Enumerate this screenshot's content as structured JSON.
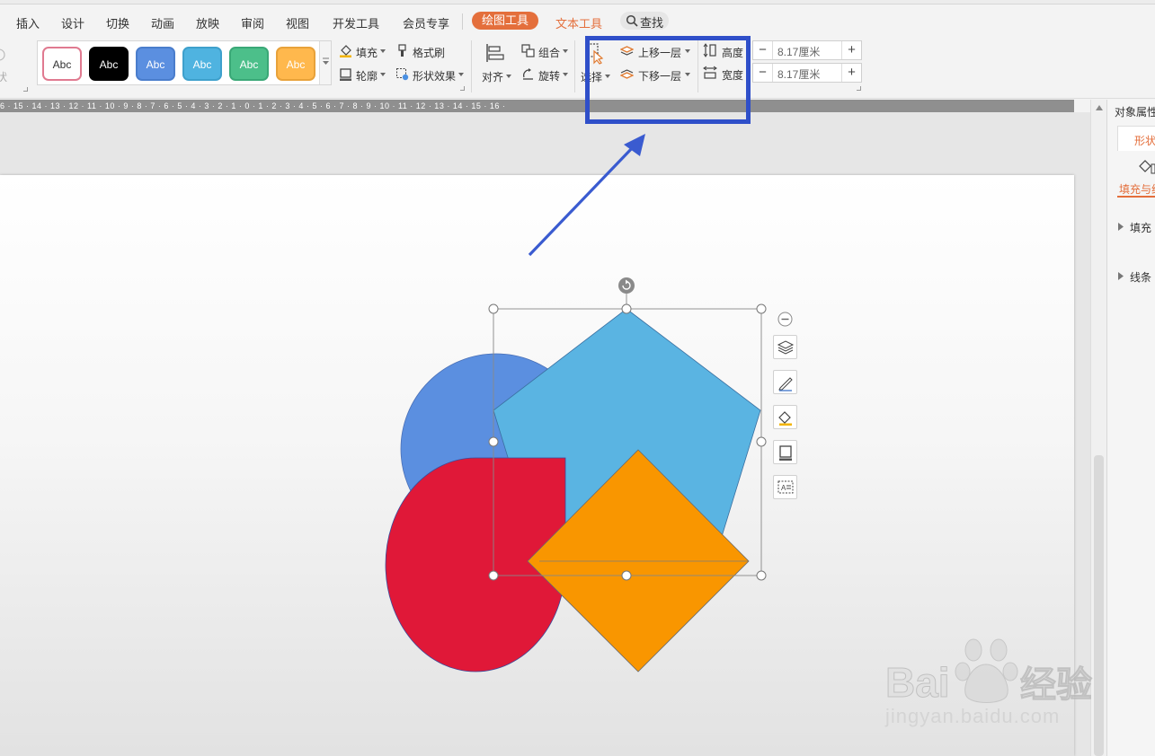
{
  "menu": {
    "items": [
      "插入",
      "设计",
      "切换",
      "动画",
      "放映",
      "审阅",
      "视图",
      "开发工具",
      "会员专享"
    ],
    "drawing_tools": "绘图工具",
    "text_tools": "文本工具",
    "search": "查找"
  },
  "ribbon": {
    "partial_shape": "状",
    "style_swatches": [
      {
        "label": "Abc",
        "bg": "#ffffff",
        "fg": "#333333",
        "border": "#e07a90"
      },
      {
        "label": "Abc",
        "bg": "#000000",
        "fg": "#ffffff",
        "border": "#000000"
      },
      {
        "label": "Abc",
        "bg": "#5b8fe0",
        "fg": "#ffffff",
        "border": "#4a7dcc"
      },
      {
        "label": "Abc",
        "bg": "#4fb3e0",
        "fg": "#ffffff",
        "border": "#3ea0cc"
      },
      {
        "label": "Abc",
        "bg": "#4cbf8a",
        "fg": "#ffffff",
        "border": "#3aa877"
      },
      {
        "label": "Abc",
        "bg": "#ffb84d",
        "fg": "#ffffff",
        "border": "#e8a23a"
      }
    ],
    "fill": "填充",
    "outline": "轮廓",
    "format_painter": "格式刷",
    "shape_effects": "形状效果",
    "align": "对齐",
    "group": "组合",
    "rotate": "旋转",
    "select": "选择",
    "bring_forward": "上移一层",
    "send_backward": "下移一层",
    "height_label": "高度",
    "width_label": "宽度",
    "height_value": "8.17厘米",
    "width_value": "8.17厘米",
    "minus": "−",
    "plus": "+"
  },
  "ruler": {
    "text": "6 · 15 · 14 · 13 · 12 · 11 · 10 · 9 · 8 · 7 · 6 · 5 · 4 · 3 · 2 · 1 · 0 · 1 · 2 · 3 · 4 · 5 · 6 · 7 · 8 · 9 · 10 · 11 · 12 · 13 · 14 · 15 · 16 ·"
  },
  "right_panel": {
    "title": "对象属性",
    "tab": "形状",
    "subtab": "填充与线",
    "fill": "填充",
    "line": "线条"
  },
  "colors": {
    "accent_orange": "#e46f3c",
    "highlight_box": "#2f4fc9",
    "arrow": "#3a5bd0",
    "circle": "#5b8fe0",
    "pentagon": "#5ab4e2",
    "red_shape": "#e01838",
    "diamond": "#f99600"
  },
  "watermark": {
    "logo": "Bai du 经验",
    "url": "jingyan.baidu.com"
  }
}
